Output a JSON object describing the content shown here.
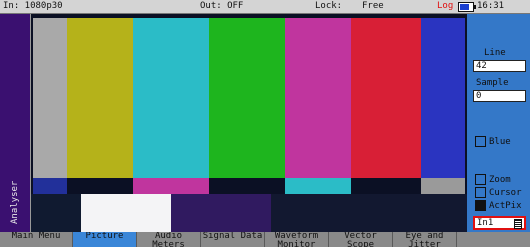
{
  "status": {
    "input": "In: 1080p30",
    "output": "Out: OFF",
    "lock_label": "Lock:",
    "lock_value": "Free",
    "log": "Log",
    "time": "16:31"
  },
  "sidebar": {
    "label": "Analyser"
  },
  "panel": {
    "line_label": "Line",
    "line_value": "42",
    "sample_label": "Sample",
    "sample_value": "0",
    "blue_label": "Blue",
    "zoom_label": "Zoom",
    "cursor_label": "Cursor",
    "actpix_label": "ActPix",
    "input_select": "In1"
  },
  "tabs": [
    {
      "label": "Main Menu"
    },
    {
      "label": "Picture"
    },
    {
      "label": "Audio Meters"
    },
    {
      "label": "Signal Data"
    },
    {
      "label": "Waveform Monitor"
    },
    {
      "label": "Vector Scope"
    },
    {
      "label": "Eye and Jitter"
    }
  ],
  "colors": {
    "accent": "#3a86d8",
    "sidebar": "#3a1070",
    "log": "#e01010",
    "bars": [
      "#a9a9a9",
      "#b5b21a",
      "#2bbcc7",
      "#1eb51e",
      "#c0359e",
      "#d81f36",
      "#2a34c0"
    ]
  }
}
